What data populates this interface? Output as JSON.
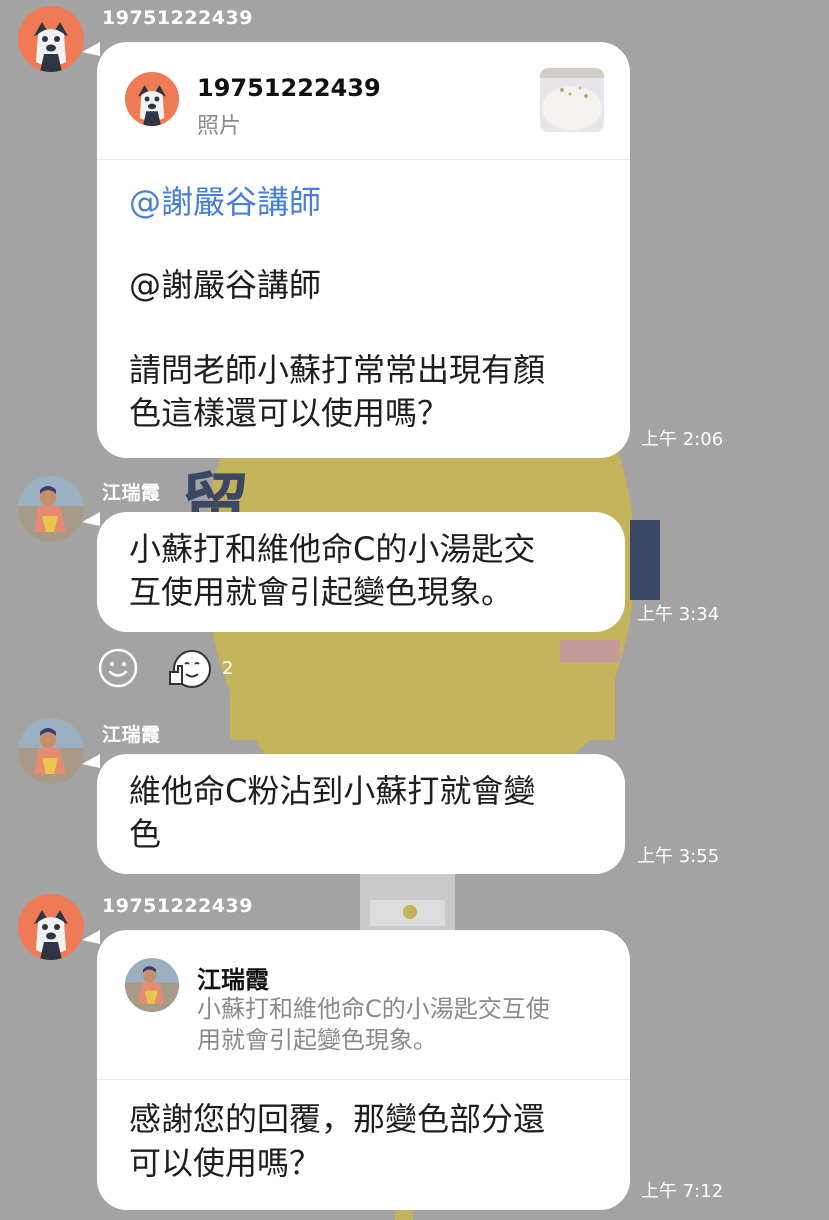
{
  "messages": [
    {
      "sender": "19751222439",
      "reply": {
        "name": "19751222439",
        "sub": "照片"
      },
      "mention": "@謝嚴谷講師",
      "line1": "@謝嚴谷講師",
      "line2": "請問老師小蘇打常常出現有顏",
      "line3": "色這樣還可以使用嗎？",
      "time": "上午 2:06"
    },
    {
      "sender": "江瑞霞",
      "line1": "小蘇打和維他命C的小湯匙交",
      "line2": "互使用就會引起變色現象。",
      "time": "上午 3:34",
      "reaction_count": "2"
    },
    {
      "sender": "江瑞霞",
      "line1": "維他命C粉沾到小蘇打就會變",
      "line2": "色",
      "time": "上午 3:55"
    },
    {
      "sender": "19751222439",
      "reply": {
        "name": "江瑞霞",
        "line1": "小蘇打和維他命C的小湯匙交互使",
        "line2": "用就會引起變色現象。"
      },
      "line1": "感謝您的回覆，那變色部分還",
      "line2": "可以使用嗎？",
      "time": "上午 7:12"
    }
  ],
  "colors": {
    "background": "#a3a3a3",
    "bubble": "#ffffff",
    "mention": "#4a7fd6",
    "dog_avatar": "#ef7a56"
  },
  "icons": [
    "dog-avatar-icon",
    "person-avatar-icon",
    "photo-thumbnail",
    "add-reaction-icon",
    "thumbs-up-face-icon"
  ]
}
